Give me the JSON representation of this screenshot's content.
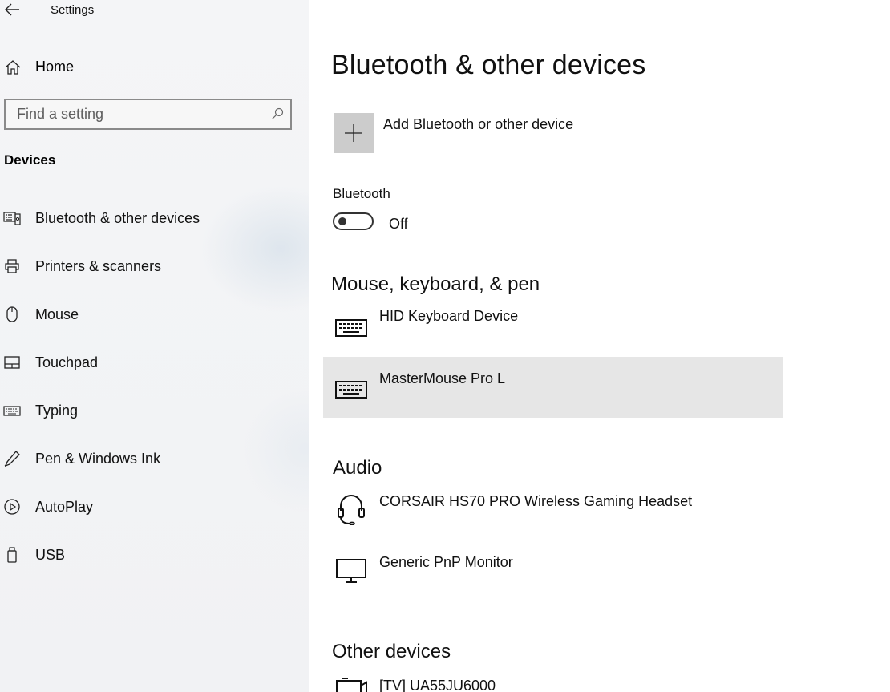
{
  "window": {
    "title": "Settings"
  },
  "sidebar": {
    "home_label": "Home",
    "search_placeholder": "Find a setting",
    "section_label": "Devices",
    "items": [
      {
        "label": "Bluetooth & other devices",
        "icon": "bluetooth-devices-icon"
      },
      {
        "label": "Printers & scanners",
        "icon": "printer-icon"
      },
      {
        "label": "Mouse",
        "icon": "mouse-icon"
      },
      {
        "label": "Touchpad",
        "icon": "touchpad-icon"
      },
      {
        "label": "Typing",
        "icon": "keyboard-icon"
      },
      {
        "label": "Pen & Windows Ink",
        "icon": "pen-icon"
      },
      {
        "label": "AutoPlay",
        "icon": "autoplay-icon"
      },
      {
        "label": "USB",
        "icon": "usb-icon"
      }
    ]
  },
  "main": {
    "title": "Bluetooth & other devices",
    "add_device_label": "Add Bluetooth or other device",
    "bluetooth": {
      "label": "Bluetooth",
      "state": "Off",
      "on": false
    },
    "groups": {
      "input": {
        "heading": "Mouse, keyboard, & pen",
        "devices": [
          {
            "name": "HID Keyboard Device",
            "icon": "keyboard-icon",
            "selected": false
          },
          {
            "name": "MasterMouse Pro L",
            "icon": "keyboard-icon",
            "selected": true
          }
        ]
      },
      "audio": {
        "heading": "Audio",
        "devices": [
          {
            "name": "CORSAIR HS70 PRO Wireless Gaming Headset",
            "icon": "headset-icon"
          },
          {
            "name": "Generic PnP Monitor",
            "icon": "monitor-icon"
          }
        ]
      },
      "other": {
        "heading": "Other devices",
        "devices": [
          {
            "name": "[TV] UA55JU6000",
            "icon": "tv-icon"
          }
        ]
      }
    }
  },
  "colors": {
    "selected_row": "#e6e6e6",
    "add_tile": "#cccccc",
    "sidebar_bg": "#f2f3f5"
  }
}
